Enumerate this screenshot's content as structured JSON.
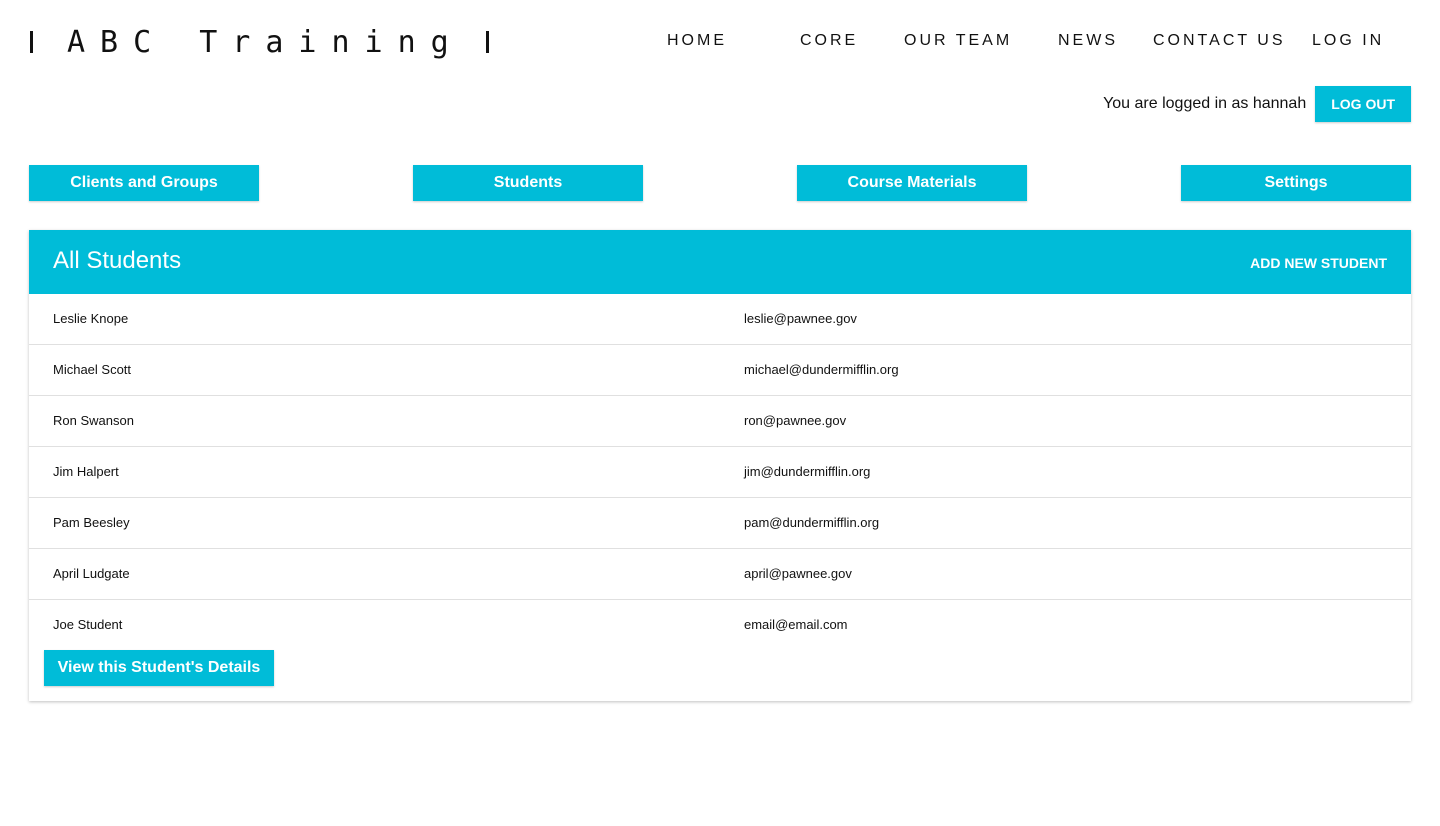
{
  "header": {
    "brand": "ABC Training",
    "nav": [
      {
        "label": "HOME"
      },
      {
        "label": "CORE"
      },
      {
        "label": "OUR TEAM"
      },
      {
        "label": "NEWS"
      },
      {
        "label": "CONTACT US"
      },
      {
        "label": "LOG IN"
      }
    ]
  },
  "session": {
    "logged_in_text": "You are logged in as hannah",
    "logout_label": "LOG OUT"
  },
  "tabs": [
    {
      "label": "Clients and Groups"
    },
    {
      "label": "Students"
    },
    {
      "label": "Course Materials"
    },
    {
      "label": "Settings"
    }
  ],
  "students_card": {
    "title": "All Students",
    "add_label": "ADD NEW STUDENT",
    "rows": [
      {
        "name": "Leslie Knope",
        "email": "leslie@pawnee.gov"
      },
      {
        "name": "Michael Scott",
        "email": "michael@dundermifflin.org"
      },
      {
        "name": "Ron Swanson",
        "email": "ron@pawnee.gov"
      },
      {
        "name": "Jim Halpert",
        "email": "jim@dundermifflin.org"
      },
      {
        "name": "Pam Beesley",
        "email": "pam@dundermifflin.org"
      },
      {
        "name": "April Ludgate",
        "email": "april@pawnee.gov"
      },
      {
        "name": "Joe Student",
        "email": "email@email.com"
      }
    ],
    "details_button": "View this Student's Details"
  },
  "colors": {
    "accent": "#00bcd8",
    "text": "#111111",
    "divider": "#e0e0e0"
  }
}
